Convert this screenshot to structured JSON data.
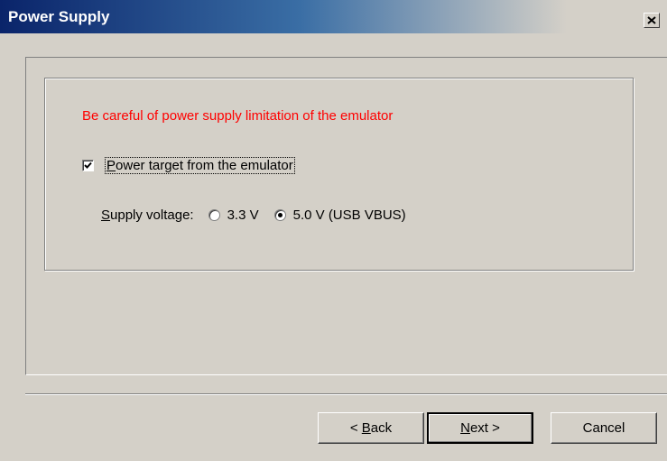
{
  "window": {
    "title": "Power Supply",
    "close_glyph": "×"
  },
  "warning_text": "Be careful of power supply limitation of the emulator",
  "power_target": {
    "label_first": "P",
    "label_rest": "ower target from the emulator",
    "checked": true
  },
  "supply_voltage": {
    "label_first": "S",
    "label_rest": "upply voltage:",
    "options": [
      {
        "label": "3.3 V",
        "selected": false
      },
      {
        "label": "5.0 V (USB VBUS)",
        "selected": true
      }
    ]
  },
  "buttons": {
    "back_prefix": "< ",
    "back_mnemonic": "B",
    "back_rest": "ack",
    "next_mnemonic": "N",
    "next_rest": "ext >",
    "cancel": "Cancel"
  },
  "colors": {
    "warning": "#ff0000",
    "title_bar_start": "#0a246a",
    "dialog_bg": "#d4d0c8"
  }
}
